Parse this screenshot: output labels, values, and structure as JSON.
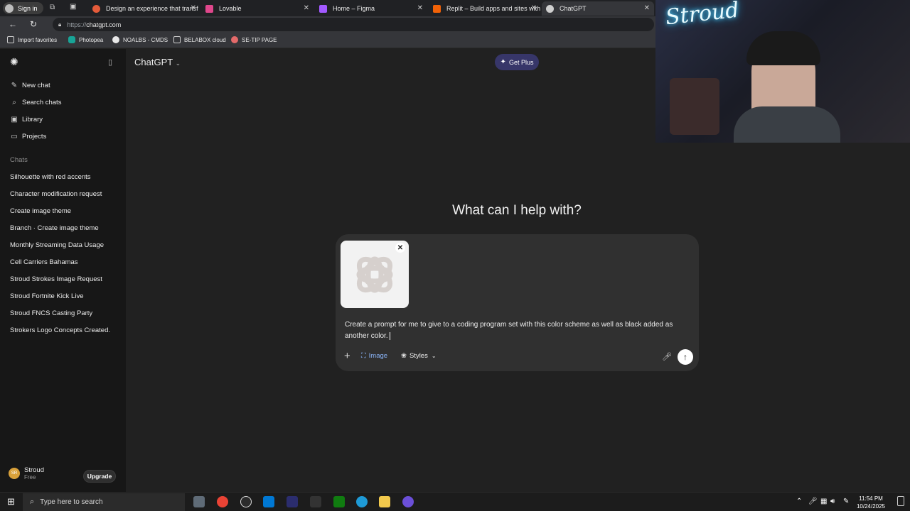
{
  "browser": {
    "signin_label": "Sign in",
    "tabs": [
      {
        "label": "Design an experience that transf",
        "color": "#e45b3a"
      },
      {
        "label": "Lovable",
        "color": "#e0478c"
      },
      {
        "label": "Home – Figma",
        "color": "#a259ff"
      },
      {
        "label": "Replit – Build apps and sites with",
        "color": "#f26207"
      },
      {
        "label": "ChatGPT",
        "color": "#cfcfcf"
      }
    ],
    "url_proto": "https://",
    "url_host": "chatgpt.com",
    "bookmarks": [
      {
        "label": "Import favorites"
      },
      {
        "label": "Photopea"
      },
      {
        "label": "NOALBS - CMDS"
      },
      {
        "label": "BELABOX cloud"
      },
      {
        "label": "SE-TIP PAGE"
      }
    ]
  },
  "sidebar": {
    "nav": [
      {
        "label": "New chat",
        "icon": "edit-icon"
      },
      {
        "label": "Search chats",
        "icon": "search-icon"
      },
      {
        "label": "Library",
        "icon": "library-icon"
      },
      {
        "label": "Projects",
        "icon": "folder-icon"
      }
    ],
    "chats_label": "Chats",
    "chats": [
      "Silhouette with red accents",
      "Character modification request",
      "Create image theme",
      "Branch · Create image theme",
      "Monthly Streaming Data Usage",
      "Cell Carriers Bahamas",
      "Stroud Strokes Image Request",
      "Stroud Fortnite Kick Live",
      "Stroud FNCS Casting Party",
      "Strokers Logo Concepts Created."
    ],
    "user": {
      "name": "Stroud",
      "plan": "Free",
      "initials": "SR"
    },
    "upgrade_label": "Upgrade"
  },
  "main": {
    "model_label": "ChatGPT",
    "get_plus_label": "Get Plus",
    "heading": "What can I help with?",
    "prompt_text": "Create a prompt for me to give to a coding program set with this color scheme as well as black added as another color.",
    "tools": {
      "image_label": "Image",
      "styles_label": "Styles"
    }
  },
  "webcam": {
    "neon_text": "Stroud"
  },
  "taskbar": {
    "search_placeholder": "Type here to search",
    "time": "11:54 PM",
    "date": "10/24/2025"
  },
  "colors": {
    "accent_plus": "#373669",
    "image_tool": "#8ab4f8"
  }
}
